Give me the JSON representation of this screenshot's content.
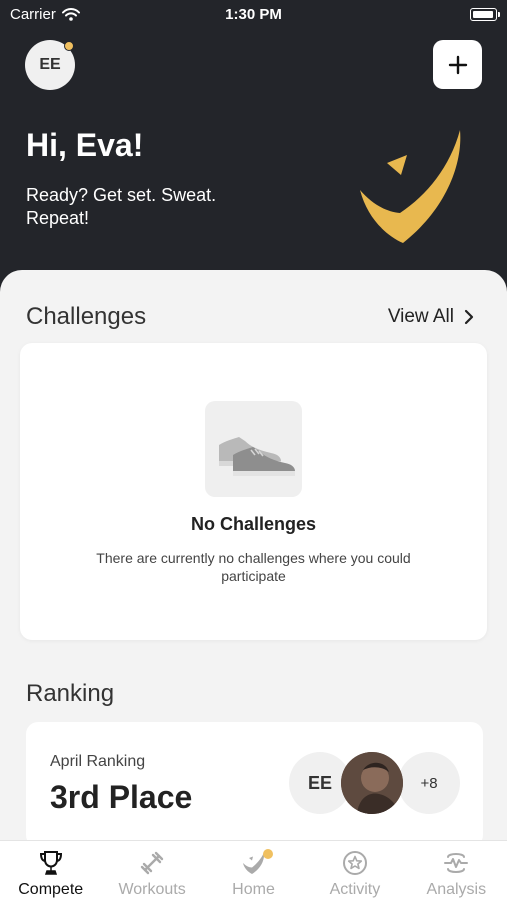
{
  "status_bar": {
    "carrier": "Carrier",
    "time": "1:30 PM"
  },
  "header": {
    "avatar_initials": "EE",
    "greeting": "Hi, Eva!",
    "tagline": "Ready? Get set. Sweat. Repeat!",
    "add_icon": "plus-icon",
    "accent_color": "#f0c060",
    "background_color": "#23252a"
  },
  "challenges": {
    "title": "Challenges",
    "view_all": "View All",
    "empty_title": "No Challenges",
    "empty_description": "There are currently no challenges where you could participate",
    "empty_icon": "sneakers-icon"
  },
  "ranking": {
    "title": "Ranking",
    "label": "April Ranking",
    "place": "3rd Place",
    "participant_initials": "EE",
    "more_count": "+8"
  },
  "tabs": [
    {
      "label": "Compete",
      "icon": "trophy-icon",
      "active": true
    },
    {
      "label": "Workouts",
      "icon": "dumbbell-icon",
      "active": false
    },
    {
      "label": "Home",
      "icon": "check-logo-icon",
      "active": false
    },
    {
      "label": "Activity",
      "icon": "star-badge-icon",
      "active": false
    },
    {
      "label": "Analysis",
      "icon": "pulse-icon",
      "active": false
    }
  ]
}
